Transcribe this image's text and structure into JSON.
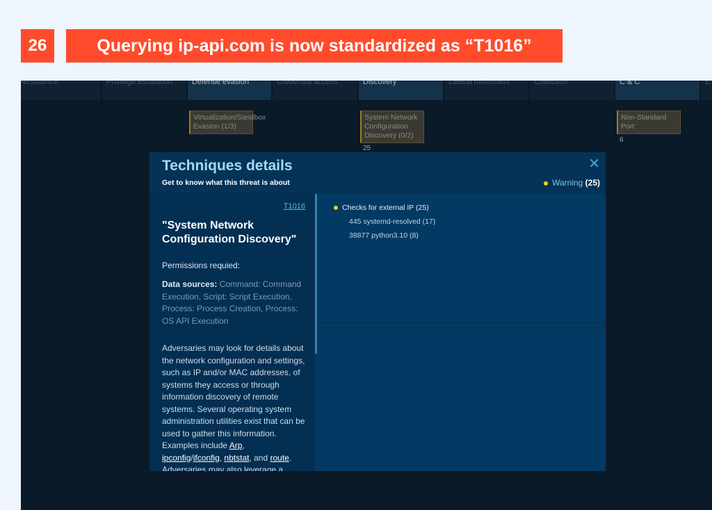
{
  "step": "26",
  "banner": "Querying ip-api.com is now standardized as “T1016”",
  "columns": [
    {
      "label": "Persistence"
    },
    {
      "label": "Privilege escalation"
    },
    {
      "label": "Defense evasion"
    },
    {
      "label": "Credential access"
    },
    {
      "label": "Discovery"
    },
    {
      "label": "Lateral movement"
    },
    {
      "label": "Collection"
    },
    {
      "label": "C & C"
    },
    {
      "label": "E"
    }
  ],
  "techniques": {
    "defense": {
      "label": "Virtualization/Sandbox Evasion (1/3)"
    },
    "discovery": {
      "label": "System Network Configuration Discovery (0/2)",
      "count": "25"
    },
    "cc": {
      "label": "Non-Standard Port",
      "count": "6"
    }
  },
  "modal": {
    "title": "Techniques details",
    "subtitle": "Get to know what this threat is about",
    "warning_label": "Warning",
    "warning_count": "(25)",
    "technique_id": "T1016",
    "technique_name": "\"System Network Configuration Discovery\"",
    "permissions": "Permissions requied:",
    "data_sources_label": "Data sources:",
    "data_sources": "Command: Command Execution, Script: Script Execution, Process: Process Creation, Process: OS API Execution",
    "desc_1": "Adversaries may look for details about the network configuration and settings, such as IP and/or MAC addresses, of systems they access or through information discovery of remote systems. Several operating system administration utilities exist that can be used to gather this information. Examples include ",
    "links": [
      "Arp",
      "ipconfig",
      "ifconfig",
      "nbtstat",
      "route"
    ],
    "desc_2": "Adversaries may also leverage a Network Device CLI on network devices",
    "check": {
      "label": "Checks for external IP (25)",
      "items": [
        "445 systemd-resolved (17)",
        "38877 python3.10 (8)"
      ]
    }
  }
}
